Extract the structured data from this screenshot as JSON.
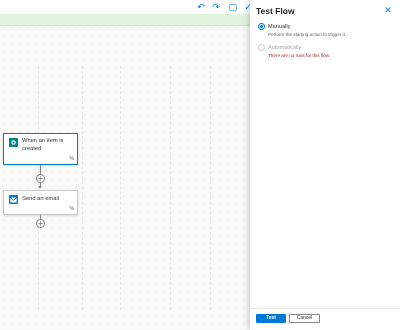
{
  "canvas": {
    "toolbar_icons": [
      "undo-icon",
      "redo-icon",
      "comment-icon",
      "check-icon"
    ],
    "trigger_card": {
      "title": "When an item is created",
      "icon": "sharepoint-icon",
      "color": "#038387"
    },
    "action_card": {
      "title": "Send an email",
      "icon": "mail-icon",
      "color": "#0078d4"
    }
  },
  "panel": {
    "title": "Test Flow",
    "options": {
      "manual": {
        "label": "Manually",
        "description": "Perform the starting action to trigger it."
      },
      "automatic": {
        "label": "Automatically",
        "error": "There are no runs for this flow."
      }
    },
    "buttons": {
      "test": "Test",
      "cancel": "Cancel"
    }
  },
  "colors": {
    "accent": "#0078d4",
    "success_banner": "#dff6dd",
    "error": "#a4262c"
  }
}
